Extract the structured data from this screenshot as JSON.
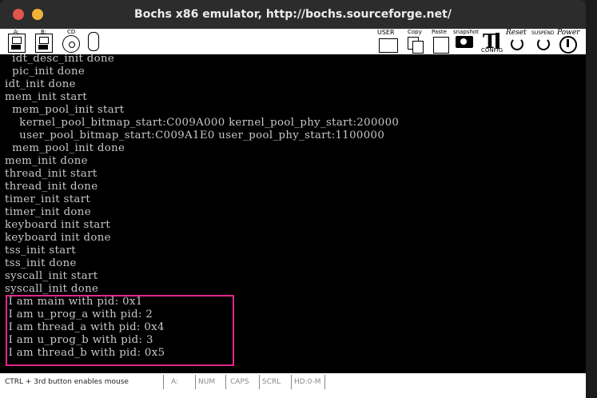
{
  "window": {
    "title": "Bochs x86 emulator, http://bochs.sourceforge.net/"
  },
  "toolbar": {
    "floppy_a_label": "A:",
    "floppy_b_label": "B:",
    "cdrom_label": "CD",
    "user_label": "USER",
    "copy_label": "Copy",
    "paste_label": "Paste",
    "snapshot_label": "snapshot",
    "config_label": "CONFIG",
    "reset_label": "Reset",
    "suspend_label": "SUSPEND",
    "power_label": "Power"
  },
  "console": {
    "lines": [
      "  idt_desc_init done",
      "  pic_init done",
      "idt_init done",
      "mem_init start",
      "  mem_pool_init start",
      "    kernel_pool_bitmap_start:C009A000 kernel_pool_phy_start:200000",
      "    user_pool_bitmap_start:C009A1E0 user_pool_phy_start:1100000",
      "  mem_pool_init done",
      "mem_init done",
      "thread_init start",
      "thread_init done",
      "timer_init start",
      "timer_init done",
      "keyboard init start",
      "keyboard init done",
      "tss_init start",
      "tss_init done",
      "syscall_init start",
      "syscall_init done",
      " I am main with pid: 0x1",
      " I am u_prog_a with pid: 2",
      " I am thread_a with pid: 0x4",
      " I am u_prog_b with pid: 3",
      " I am thread_b with pid: 0x5"
    ],
    "highlight_color": "#e0288c"
  },
  "statusbar": {
    "hint": "CTRL + 3rd button enables mouse",
    "drive": "A:",
    "num": "NUM",
    "caps": "CAPS",
    "scrl": "SCRL",
    "hd": "HD:0-M"
  }
}
